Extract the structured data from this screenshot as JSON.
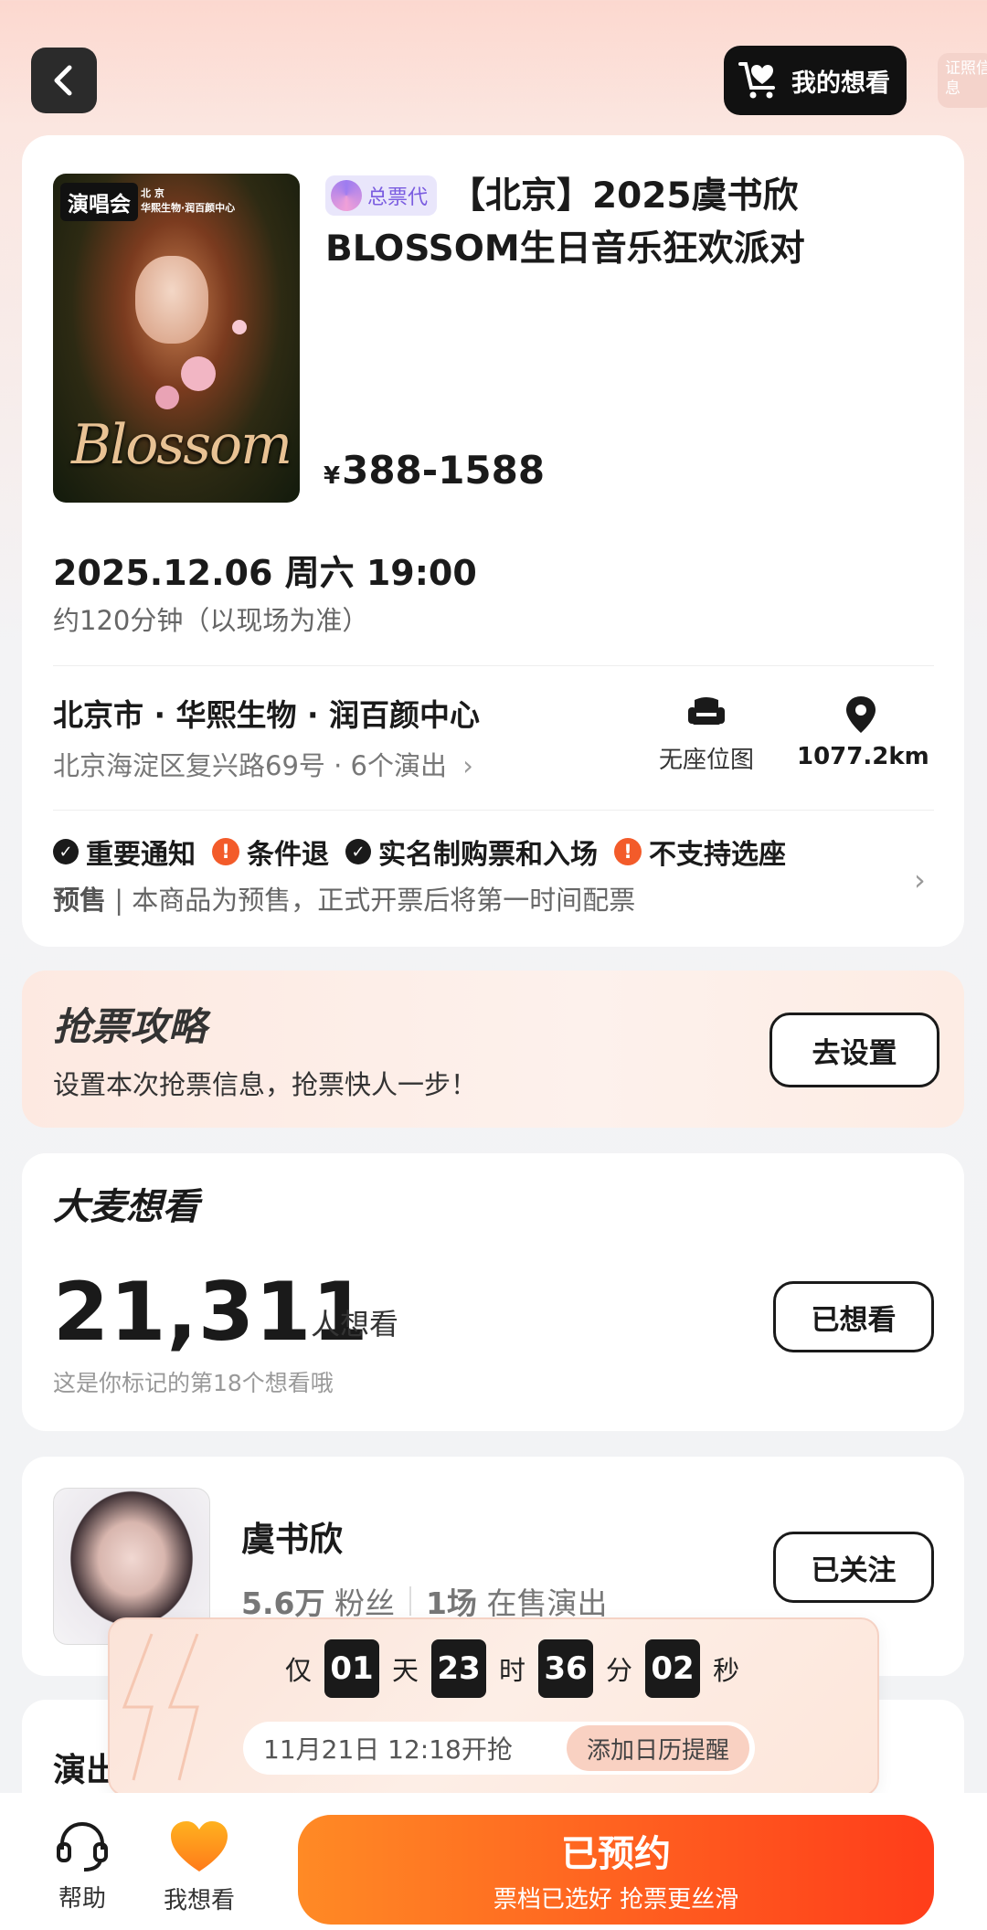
{
  "header": {
    "back_label": "返回",
    "want_button_label": "我的想看",
    "license_label": "证照信息"
  },
  "event": {
    "poster_tag": "演唱会",
    "poster_sub": "北 京\n华熙生物·润百颜中心",
    "poster_word": "Blossom",
    "agency_badge": "总票代",
    "title": "【北京】2025虞书欣BLOSSOM生日音乐狂欢派对",
    "price_symbol": "¥",
    "price": "388-1588",
    "datetime": "2025.12.06 周六 19:00",
    "duration": "约120分钟（以现场为准）",
    "venue": "北京市 · 华熙生物 · 润百颜中心",
    "address": "北京海淀区复兴路69号 · 6个演出",
    "seat_map_label": "无座位图",
    "distance": "1077.2km"
  },
  "notices": {
    "items": [
      {
        "label": "重要通知",
        "type": "check"
      },
      {
        "label": "条件退",
        "type": "warn"
      },
      {
        "label": "实名制购票和入场",
        "type": "check"
      },
      {
        "label": "不支持选座",
        "type": "warn"
      }
    ],
    "presale_tag": "预售",
    "presale_text": " | 本商品为预售，正式开票后将第一时间配票"
  },
  "strategy": {
    "title": "抢票攻略",
    "subtitle": "设置本次抢票信息，抢票快人一步！",
    "button": "去设置"
  },
  "want": {
    "title": "大麦想看",
    "count": "21,311",
    "unit": "人想看",
    "sub": "这是你标记的第18个想看哦",
    "button": "已想看"
  },
  "artist": {
    "name": "虞书欣",
    "fans_value": "5.6万",
    "fans_label": "粉丝",
    "shows_value": "1场",
    "shows_label": "在售演出",
    "button": "已关注"
  },
  "show_section": {
    "title": "演出"
  },
  "countdown": {
    "prefix": "仅",
    "days": "01",
    "days_label": "天",
    "hours": "23",
    "hours_label": "时",
    "minutes": "36",
    "minutes_label": "分",
    "seconds": "02",
    "seconds_label": "秒",
    "open_time": "11月21日 12:18开抢",
    "calendar_button": "添加日历提醒"
  },
  "bottom": {
    "help_label": "帮助",
    "want_label": "我想看",
    "reserve_main": "已预约",
    "reserve_sub": "票档已选好 抢票更丝滑"
  },
  "colors": {
    "accent": "#ff5a1f",
    "warn": "#f35b2a",
    "agency": "#7a5ce0"
  }
}
